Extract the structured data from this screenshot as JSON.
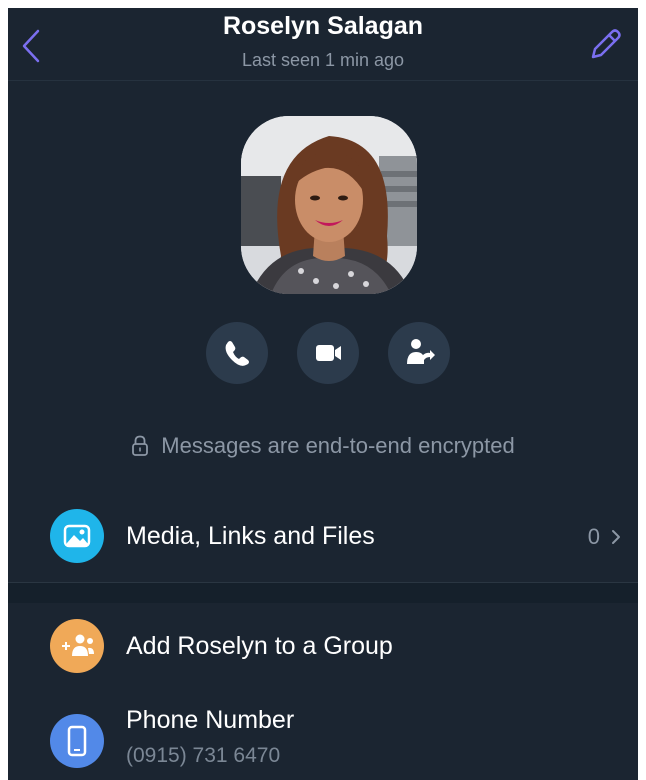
{
  "header": {
    "title": "Roselyn Salagan",
    "subtitle": "Last seen 1 min ago",
    "back_icon": "chevron-left-icon",
    "edit_icon": "pencil-icon"
  },
  "profile": {
    "avatar_icon": "profile-photo"
  },
  "actions": [
    {
      "name": "voice-call",
      "icon": "phone-icon"
    },
    {
      "name": "video-call",
      "icon": "video-camera-icon"
    },
    {
      "name": "share-contact",
      "icon": "share-contact-icon"
    }
  ],
  "encryption": {
    "icon": "lock-icon",
    "text": "Messages are end-to-end encrypted"
  },
  "media_row": {
    "label": "Media, Links and Files",
    "count": "0",
    "icon": "image-icon",
    "icon_color": "#1fb5ea"
  },
  "group_row": {
    "label": "Add Roselyn to a Group",
    "icon": "add-people-icon",
    "icon_color": "#f0a958"
  },
  "phone_row": {
    "label": "Phone Number",
    "number": "(0915) 731 6470",
    "icon": "phone-device-icon",
    "icon_color": "#5289e8"
  },
  "colors": {
    "background": "#1b2531",
    "accent": "#7b6ff0",
    "secondary_text": "#8c97a5",
    "button_bg": "#2c3b4c"
  }
}
